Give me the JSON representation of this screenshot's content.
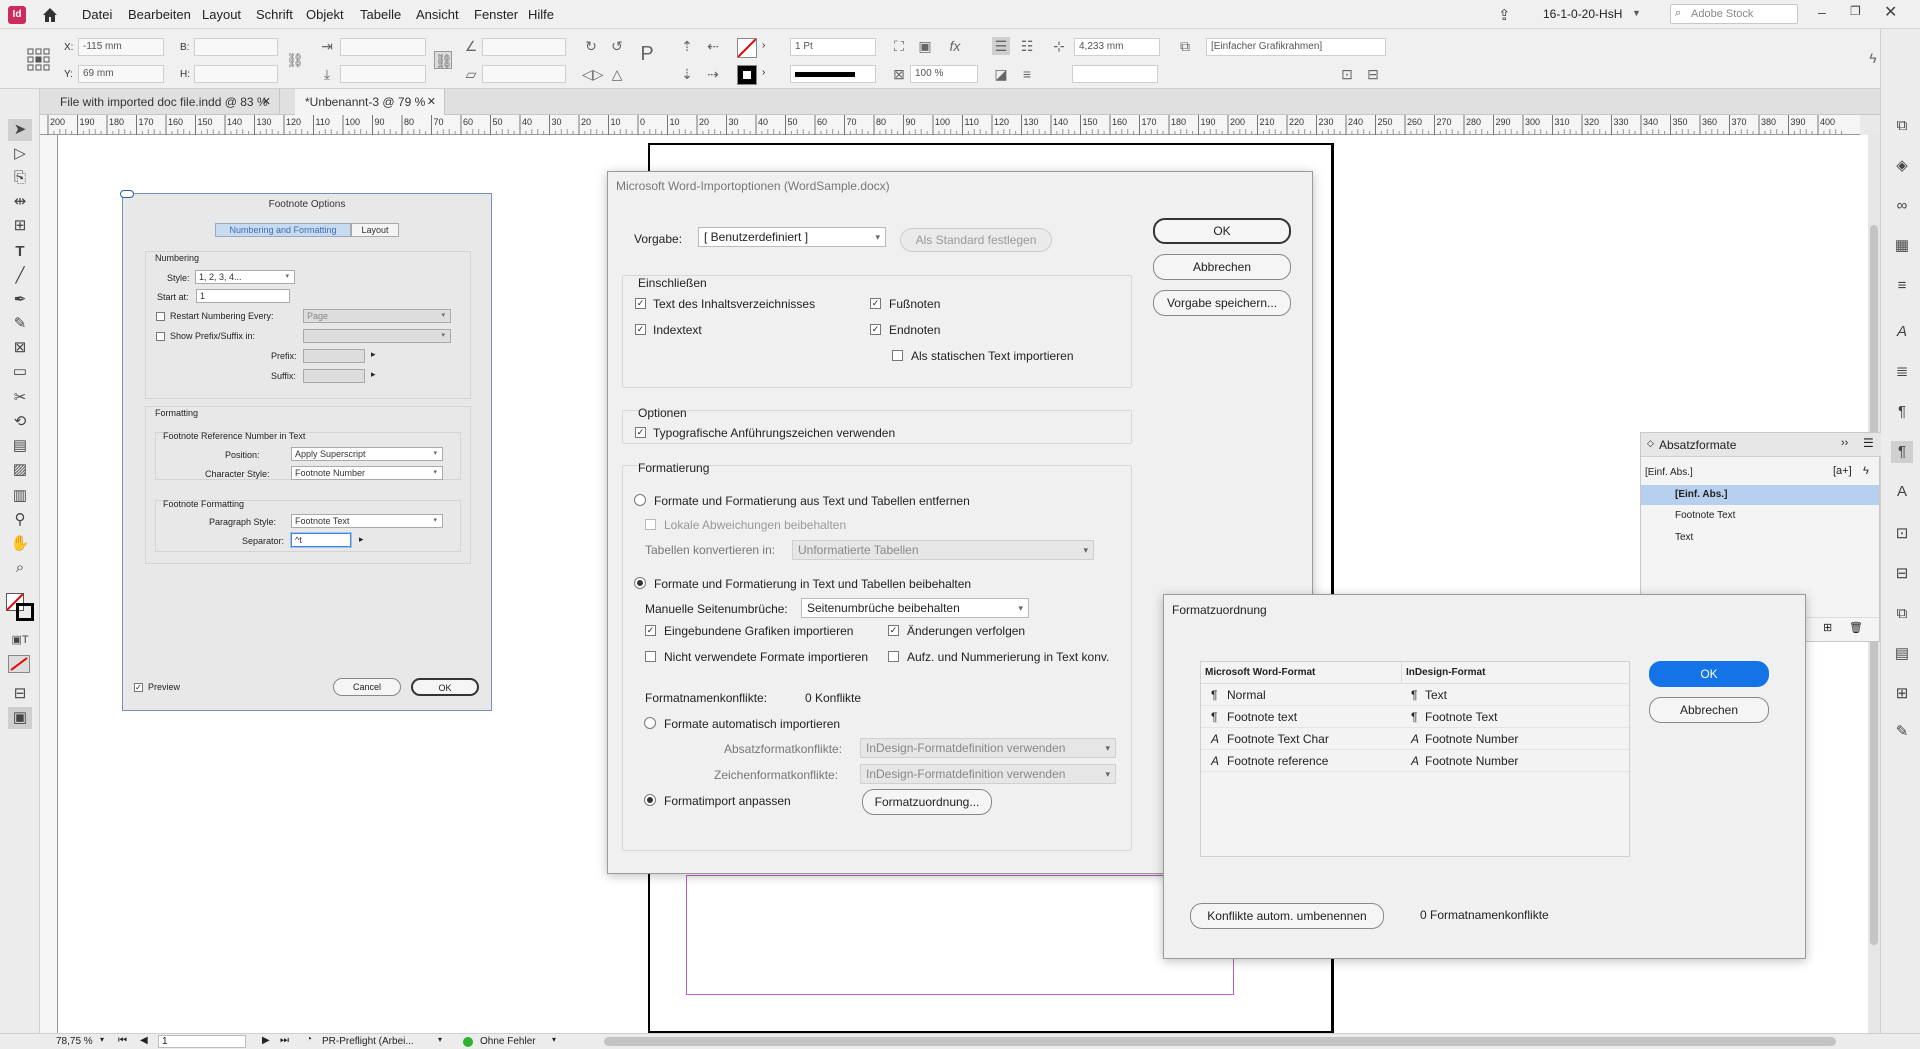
{
  "menubar": {
    "app_icon": "Id",
    "items": [
      "Datei",
      "Bearbeiten",
      "Layout",
      "Schrift",
      "Objekt",
      "Tabelle",
      "Ansicht",
      "Fenster",
      "Hilfe"
    ],
    "workspace": "16-1-0-20-HsH",
    "search_placeholder": "Adobe Stock"
  },
  "control": {
    "x_label": "X:",
    "x_value": "-115 mm",
    "y_label": "Y:",
    "y_value": "69 mm",
    "b_label": "B:",
    "h_label": "H:",
    "stroke_weight": "1 Pt",
    "scale": "100 %",
    "offset": "4,233 mm",
    "frame_style": "[Einfacher Grafikrahmen]"
  },
  "tabs": [
    {
      "label": "File with imported doc file.indd @ 83 %"
    },
    {
      "label": "*Unbenannt-3 @ 79 %"
    }
  ],
  "ruler": {
    "h_ticks": [
      "200",
      "190",
      "180",
      "170",
      "160",
      "150",
      "140",
      "130",
      "120",
      "110",
      "100",
      "90",
      "80",
      "70",
      "60",
      "50",
      "40",
      "30",
      "20",
      "10",
      "0",
      "10",
      "20",
      "30",
      "40",
      "50",
      "60",
      "70",
      "80",
      "90",
      "100",
      "110",
      "120",
      "130",
      "140",
      "150",
      "160",
      "170",
      "180",
      "190",
      "200",
      "210",
      "220",
      "230",
      "240",
      "250",
      "260",
      "270",
      "280",
      "290",
      "300",
      "310",
      "320",
      "330",
      "340",
      "350",
      "360",
      "370",
      "380",
      "390",
      "400"
    ]
  },
  "status": {
    "zoom": "78,75 %",
    "page": "1",
    "preflight_profile": "PR-Preflight (Arbei...",
    "errors": "Ohne Fehler"
  },
  "footnote": {
    "title": "Footnote Options",
    "tab_numbering": "Numbering and Formatting",
    "tab_layout": "Layout",
    "numbering_heading": "Numbering",
    "style_label": "Style:",
    "style_value": "1, 2, 3, 4...",
    "start_label": "Start at:",
    "start_value": "1",
    "restart_label": "Restart Numbering Every:",
    "restart_value": "Page",
    "prefix_suffix_label": "Show Prefix/Suffix in:",
    "prefix_label": "Prefix:",
    "suffix_label": "Suffix:",
    "formatting_heading": "Formatting",
    "ref_heading": "Footnote Reference Number in Text",
    "position_label": "Position:",
    "position_value": "Apply Superscript",
    "charstyle_label": "Character Style:",
    "charstyle_value": "Footnote Number",
    "fn_formatting_heading": "Footnote Formatting",
    "parastyle_label": "Paragraph Style:",
    "parastyle_value": "Footnote Text",
    "separator_label": "Separator:",
    "separator_value": "^t",
    "preview_label": "Preview",
    "cancel": "Cancel",
    "ok": "OK"
  },
  "word_import": {
    "title": "Microsoft Word-Importoptionen (WordSample.docx)",
    "preset_label": "Vorgabe:",
    "preset_value": "[ Benutzerdefiniert ]",
    "set_default": "Als Standard festlegen",
    "ok": "OK",
    "cancel": "Abbrechen",
    "save_preset": "Vorgabe speichern...",
    "include_title": "Einschließen",
    "toc_text": "Text des Inhaltsverzeichnisses",
    "index_text": "Indextext",
    "footnotes": "Fußnoten",
    "endnotes": "Endnoten",
    "static_text": "Als statischen Text importieren",
    "options_title": "Optionen",
    "typo_quotes": "Typografische Anführungszeichen verwenden",
    "formatting_title": "Formatierung",
    "remove_formats": "Formate und Formatierung aus Text und Tabellen entfernen",
    "keep_local": "Lokale Abweichungen beibehalten",
    "convert_tables_label": "Tabellen konvertieren in:",
    "convert_tables_value": "Unformatierte Tabellen",
    "keep_formats": "Formate und Formatierung in Text und Tabellen beibehalten",
    "page_breaks_label": "Manuelle Seitenumbrüche:",
    "page_breaks_value": "Seitenumbrüche beibehalten",
    "inline_graphics": "Eingebundene Grafiken importieren",
    "track_changes": "Änderungen verfolgen",
    "unused_styles": "Nicht verwendete Formate importieren",
    "bullets_to_text": "Aufz. und Nummerierung in Text konv.",
    "conflicts_label": "Formatnamenkonflikte:",
    "conflicts_value": "0 Konflikte",
    "auto_import": "Formate automatisch importieren",
    "para_conflicts_label": "Absatzformatkonflikte:",
    "para_conflicts_value": "InDesign-Formatdefinition verwenden",
    "char_conflicts_label": "Zeichenformatkonflikte:",
    "char_conflicts_value": "InDesign-Formatdefinition verwenden",
    "custom_import": "Formatimport anpassen",
    "style_mapping_button": "Formatzuordnung..."
  },
  "style_mapping": {
    "title": "Formatzuordnung",
    "col_word": "Microsoft Word-Format",
    "col_indesign": "InDesign-Format",
    "rows": [
      {
        "word": "Normal",
        "indesign": "Text",
        "word_icon": "¶",
        "indesign_icon": "¶"
      },
      {
        "word": "Footnote text",
        "indesign": "Footnote Text",
        "word_icon": "¶",
        "indesign_icon": "¶"
      },
      {
        "word": "Footnote Text Char",
        "indesign": "Footnote Number",
        "word_icon": "A",
        "indesign_icon": "A"
      },
      {
        "word": "Footnote reference",
        "indesign": "Footnote Number",
        "word_icon": "A",
        "indesign_icon": "A"
      }
    ],
    "ok": "OK",
    "cancel": "Abbrechen",
    "auto_rename": "Konflikte autom. umbenennen",
    "conflicts": "0 Formatnamenkonflikte"
  },
  "para_panel": {
    "title": "Absatzformate",
    "current": "[Einf. Abs.]",
    "items": [
      "[Einf. Abs.]",
      "Footnote Text",
      "Text"
    ]
  }
}
